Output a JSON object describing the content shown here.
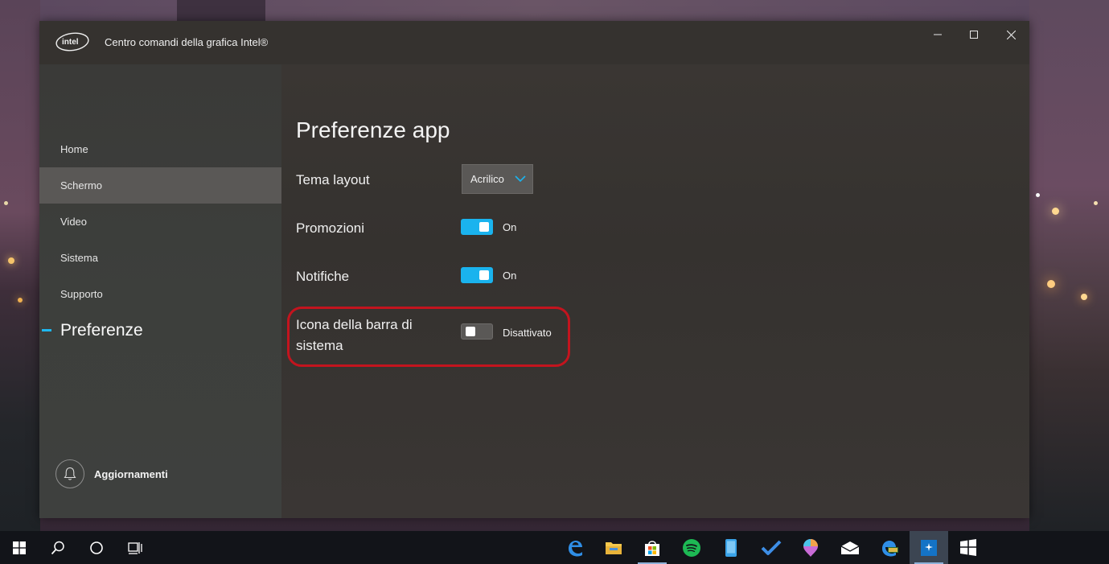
{
  "window": {
    "title": "Centro comandi della grafica Intel®",
    "logo_text": "intel"
  },
  "sidebar": {
    "items": [
      {
        "label": "Home"
      },
      {
        "label": "Schermo"
      },
      {
        "label": "Video"
      },
      {
        "label": "Sistema"
      },
      {
        "label": "Supporto"
      },
      {
        "label": "Preferenze"
      }
    ],
    "updates_label": "Aggiornamenti"
  },
  "main": {
    "title": "Preferenze app",
    "layout_theme": {
      "label": "Tema layout",
      "value": "Acrilico"
    },
    "promotions": {
      "label": "Promozioni",
      "state": "On"
    },
    "notifications": {
      "label": "Notifiche",
      "state": "On"
    },
    "tray_icon": {
      "label": "Icona della barra di sistema",
      "state": "Disattivato"
    }
  },
  "colors": {
    "accent": "#1ab3ee",
    "highlight_ring": "#c3141e"
  },
  "taskbar": {
    "icons": [
      "start-icon",
      "search-icon",
      "cortana-icon",
      "task-view-icon",
      "edge-icon",
      "file-explorer-icon",
      "store-icon",
      "spotify-icon",
      "phone-icon",
      "todo-icon",
      "paint3d-icon",
      "mail-icon",
      "edge-dev-icon",
      "intel-graphics-icon",
      "app-icon"
    ]
  }
}
